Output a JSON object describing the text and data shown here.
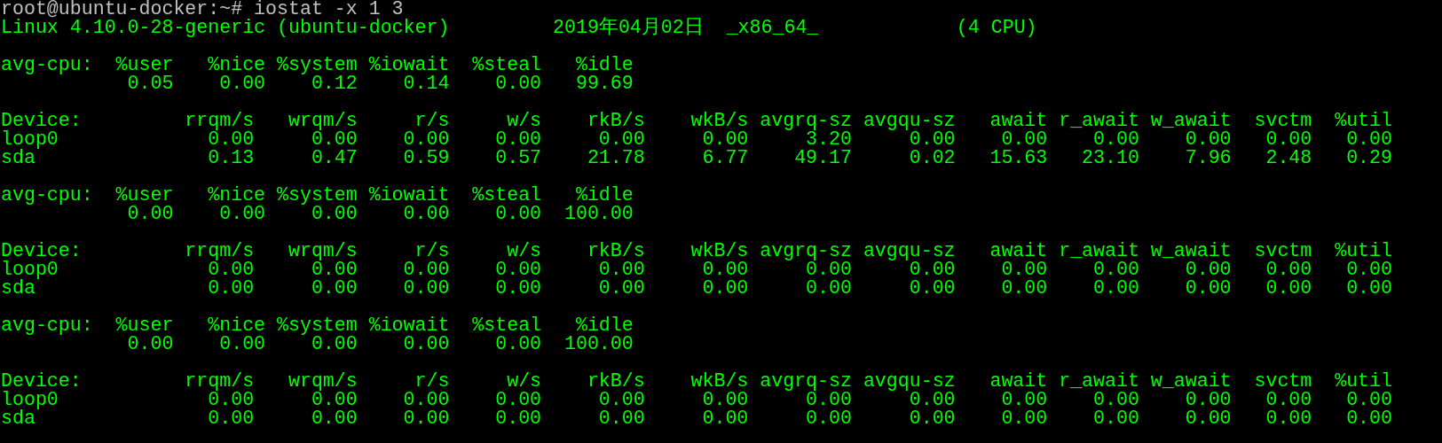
{
  "lines": [
    {
      "kind": "prompt",
      "text": "root@ubuntu-docker:~# iostat -x 1 3"
    },
    {
      "kind": "sysinfo",
      "parts": [
        "Linux 4.10.0-28-generic (ubuntu-docker)",
        "2019年04月02日",
        "_x86_64_",
        "(4 CPU)"
      ]
    },
    {
      "kind": "blank"
    },
    {
      "kind": "output",
      "text": "avg-cpu:  %user   %nice %system %iowait  %steal   %idle"
    },
    {
      "kind": "output",
      "text": "           0.05    0.00    0.12    0.14    0.00   99.69"
    },
    {
      "kind": "blank"
    },
    {
      "kind": "output",
      "text": "Device:         rrqm/s   wrqm/s     r/s     w/s    rkB/s    wkB/s avgrq-sz avgqu-sz   await r_await w_await  svctm  %util"
    },
    {
      "kind": "output",
      "text": "loop0             0.00     0.00    0.00    0.00     0.00     0.00     3.20     0.00    0.00    0.00    0.00   0.00   0.00"
    },
    {
      "kind": "output",
      "text": "sda               0.13     0.47    0.59    0.57    21.78     6.77    49.17     0.02   15.63   23.10    7.96   2.48   0.29"
    },
    {
      "kind": "blank"
    },
    {
      "kind": "output",
      "text": "avg-cpu:  %user   %nice %system %iowait  %steal   %idle"
    },
    {
      "kind": "output",
      "text": "           0.00    0.00    0.00    0.00    0.00  100.00"
    },
    {
      "kind": "blank"
    },
    {
      "kind": "output",
      "text": "Device:         rrqm/s   wrqm/s     r/s     w/s    rkB/s    wkB/s avgrq-sz avgqu-sz   await r_await w_await  svctm  %util"
    },
    {
      "kind": "output",
      "text": "loop0             0.00     0.00    0.00    0.00     0.00     0.00     0.00     0.00    0.00    0.00    0.00   0.00   0.00"
    },
    {
      "kind": "output",
      "text": "sda               0.00     0.00    0.00    0.00     0.00     0.00     0.00     0.00    0.00    0.00    0.00   0.00   0.00"
    },
    {
      "kind": "blank"
    },
    {
      "kind": "output",
      "text": "avg-cpu:  %user   %nice %system %iowait  %steal   %idle"
    },
    {
      "kind": "output",
      "text": "           0.00    0.00    0.00    0.00    0.00  100.00"
    },
    {
      "kind": "blank"
    },
    {
      "kind": "output",
      "text": "Device:         rrqm/s   wrqm/s     r/s     w/s    rkB/s    wkB/s avgrq-sz avgqu-sz   await r_await w_await  svctm  %util"
    },
    {
      "kind": "output",
      "text": "loop0             0.00     0.00    0.00    0.00     0.00     0.00     0.00     0.00    0.00    0.00    0.00   0.00   0.00"
    },
    {
      "kind": "output",
      "text": "sda               0.00     0.00    0.00    0.00     0.00     0.00     0.00     0.00    0.00    0.00    0.00   0.00   0.00"
    }
  ]
}
